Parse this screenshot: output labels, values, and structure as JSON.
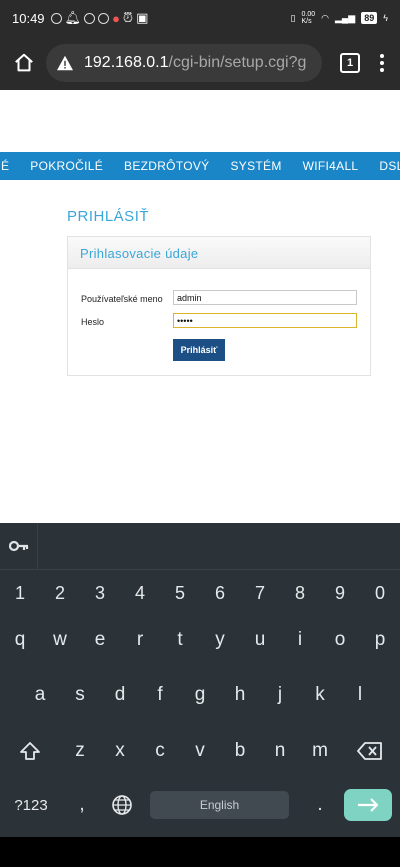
{
  "status": {
    "time": "10:49",
    "net_speed": "0.00\nK/s",
    "battery": "89"
  },
  "browser": {
    "url_host": "192.168.0.1",
    "url_path": "/cgi-bin/setup.cgi?g",
    "tab_count": "1"
  },
  "nav": {
    "items": [
      "NÉ",
      "POKROČILÉ",
      "BEZDRÔTOVÝ",
      "SYSTÉM",
      "WIFI4ALL",
      "DSLITE"
    ]
  },
  "login": {
    "title": "PRIHLÁSIŤ",
    "panel_title": "Prihlasovacie údaje",
    "username_label": "Používateľské meno",
    "username_value": "admin",
    "password_label": "Heslo",
    "password_value": "•••••",
    "button": "Prihlásiť"
  },
  "keyboard": {
    "numbers": [
      "1",
      "2",
      "3",
      "4",
      "5",
      "6",
      "7",
      "8",
      "9",
      "0"
    ],
    "row1": [
      "q",
      "w",
      "e",
      "r",
      "t",
      "y",
      "u",
      "i",
      "o",
      "p"
    ],
    "row2": [
      "a",
      "s",
      "d",
      "f",
      "g",
      "h",
      "j",
      "k",
      "l"
    ],
    "row3": [
      "z",
      "x",
      "c",
      "v",
      "b",
      "n",
      "m"
    ],
    "symbols_key": "?123",
    "comma": ",",
    "period": ".",
    "space_label": "English"
  },
  "colors": {
    "nav_bg": "#1a86c8",
    "accent_text": "#3ba6d9",
    "login_button": "#1b4f86",
    "enter_key": "#7fd3c3"
  }
}
